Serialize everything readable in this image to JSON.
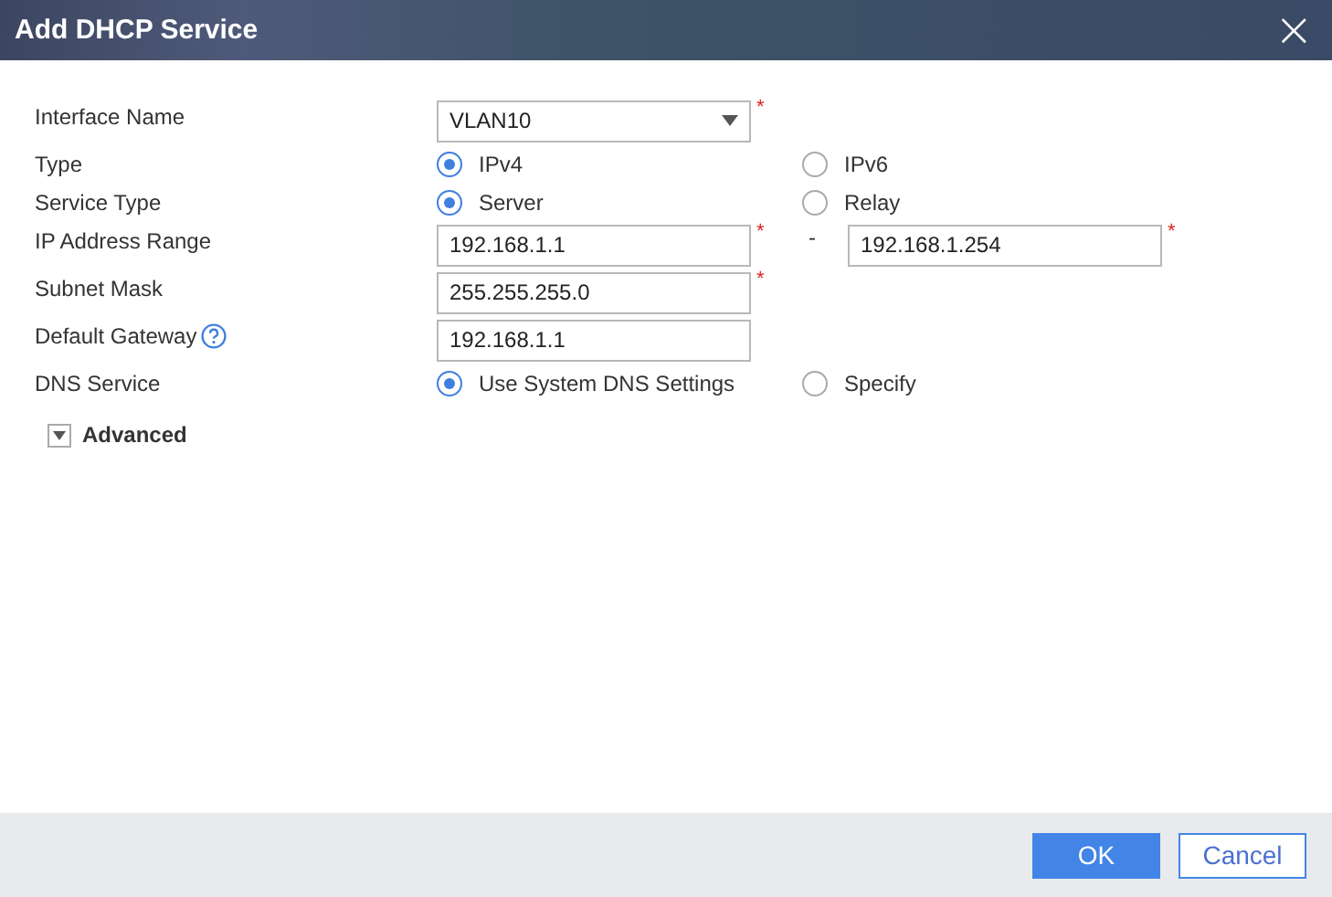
{
  "window": {
    "title": "Add DHCP Service",
    "close": "×"
  },
  "fields": [
    {
      "kind": "select",
      "label": "Interface Name",
      "value": "VLAN10",
      "required_mark": "*"
    },
    {
      "kind": "radio",
      "label": "Type",
      "options": [
        {
          "label": "IPv4",
          "selected": true
        },
        {
          "label": "IPv6",
          "selected": false
        }
      ]
    },
    {
      "kind": "radio",
      "label": "Service Type",
      "options": [
        {
          "label": "Server",
          "selected": true
        },
        {
          "label": "Relay",
          "selected": false
        }
      ]
    },
    {
      "kind": "range",
      "label": "IP Address Range",
      "value": "192.168.1.1",
      "separator": "-",
      "value_end": "192.168.1.254",
      "required_mark": "*",
      "required_mark_end": "*"
    },
    {
      "kind": "input",
      "label": "Subnet Mask",
      "value": "255.255.255.0",
      "required_mark": "*"
    },
    {
      "kind": "input",
      "label": "Default Gateway",
      "value": "192.168.1.1",
      "help": true
    },
    {
      "kind": "radio",
      "label": "DNS Service",
      "options": [
        {
          "label": "Use System DNS Settings",
          "selected": true
        },
        {
          "label": "Specify",
          "selected": false
        }
      ]
    }
  ],
  "advanced": {
    "label": "Advanced",
    "expanded": false
  },
  "buttons": [
    {
      "label": "OK",
      "kind": "primary"
    },
    {
      "label": "Cancel",
      "kind": "secondary"
    }
  ]
}
